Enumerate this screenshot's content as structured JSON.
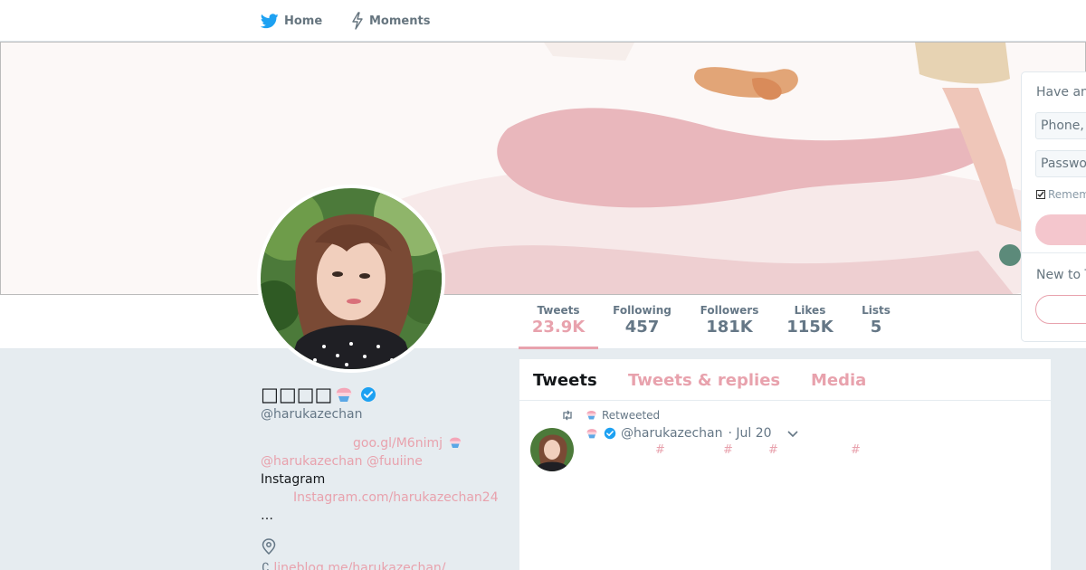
{
  "nav": {
    "home_label": "Home",
    "moments_label": "Moments"
  },
  "profile": {
    "display_name": "□□□□",
    "handle": "@harukazechan",
    "bio": {
      "link1": "goo.gl/M6nimj",
      "mentions": "@harukazechan @fuuiine",
      "instagram_label": "Instagram",
      "instagram_link": "Instagram.com/harukazechan24",
      "ellipsis": "…"
    },
    "website": "lineblog.me/harukazechan/"
  },
  "stats": [
    {
      "label": "Tweets",
      "value": "23.9K"
    },
    {
      "label": "Following",
      "value": "457"
    },
    {
      "label": "Followers",
      "value": "181K"
    },
    {
      "label": "Likes",
      "value": "115K"
    },
    {
      "label": "Lists",
      "value": "5"
    }
  ],
  "timeline": {
    "tabs": [
      "Tweets",
      "Tweets & replies",
      "Media"
    ],
    "tweet": {
      "retweeted_label": "Retweeted",
      "handle": "@harukazechan",
      "date": "· Jul 20",
      "hashes": [
        "#",
        "#",
        "#",
        "#"
      ]
    }
  },
  "login": {
    "have_account": "Have an",
    "phone_placeholder": "Phone,",
    "password_placeholder": "Password",
    "remember": "Rememb",
    "new_to": "New to T"
  },
  "colors": {
    "accent": "#e8a2ad",
    "verified": "#1da1f2",
    "bird": "#1da1f2"
  },
  "icons": {
    "home": "twitter-bird-icon",
    "moments": "lightning-icon",
    "verified": "verified-badge-icon",
    "retweet": "retweet-icon",
    "caret": "chevron-down-icon",
    "location": "location-pin-icon",
    "emoji": "shaved-ice-emoji"
  }
}
